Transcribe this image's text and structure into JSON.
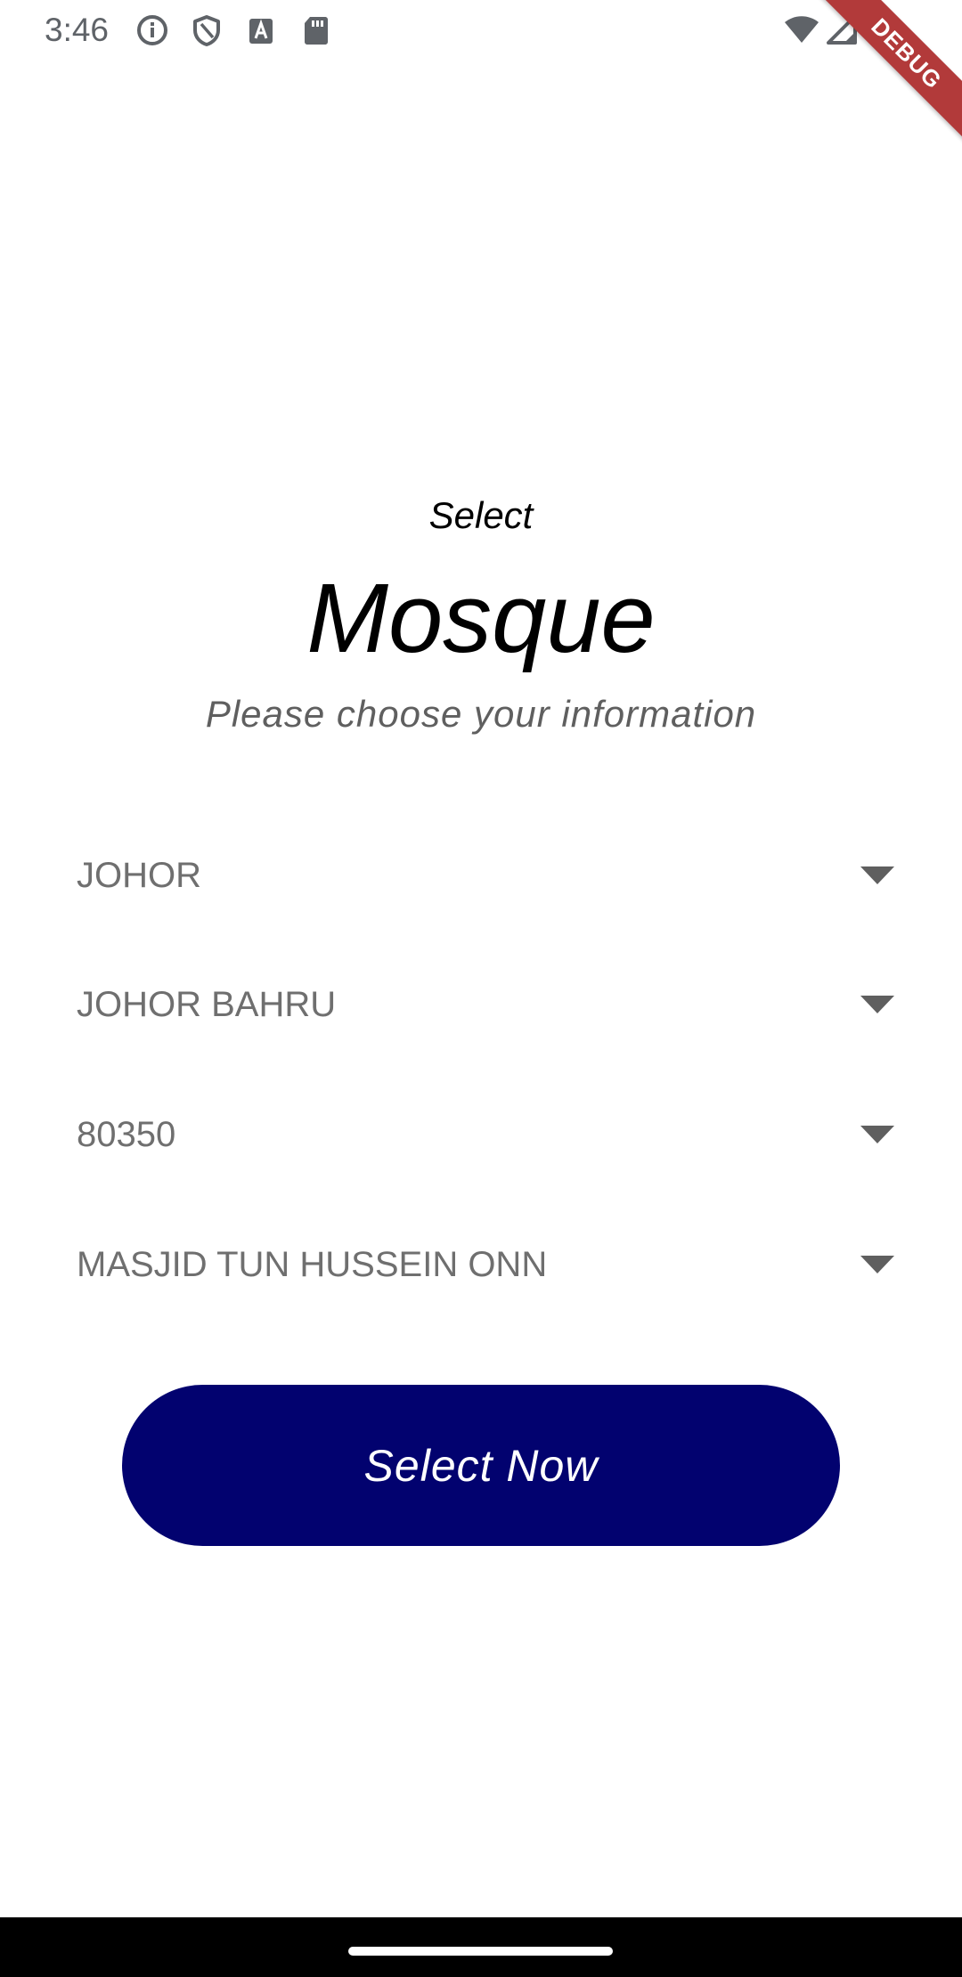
{
  "status_bar": {
    "time": "3:46",
    "icons": [
      "info-icon",
      "shield-icon",
      "text-a-icon",
      "sd-card-icon",
      "wifi-icon",
      "signal-icon"
    ]
  },
  "debug_banner": {
    "label": "DEBUG",
    "color": "#b23a3a"
  },
  "header": {
    "pre_title": "Select",
    "title": "Mosque",
    "subtitle": "Please choose your information"
  },
  "form": {
    "state": "JOHOR",
    "district": "JOHOR BAHRU",
    "postcode": "80350",
    "mosque": "MASJID TUN HUSSEIN ONN"
  },
  "actions": {
    "select_label": "Select Now",
    "button_color": "#02026f"
  }
}
